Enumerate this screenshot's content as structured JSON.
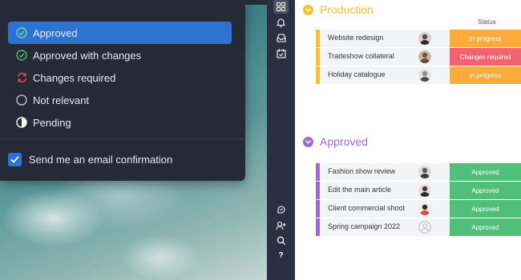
{
  "menu": {
    "options": [
      {
        "label": "Approved",
        "icon": "check-circle-icon",
        "selected": true
      },
      {
        "label": "Approved with changes",
        "icon": "check-circle-icon",
        "selected": false
      },
      {
        "label": "Changes required",
        "icon": "refresh-icon",
        "selected": false
      },
      {
        "label": "Not relevant",
        "icon": "empty-circle-icon",
        "selected": false
      },
      {
        "label": "Pending",
        "icon": "half-circle-icon",
        "selected": false
      }
    ],
    "email_confirmation": {
      "label": "Send me an email confirmation",
      "checked": true
    }
  },
  "sidebar": {
    "icons": [
      "grid-icon",
      "bell-icon",
      "inbox-icon",
      "calendar-check-icon",
      "feedback-icon",
      "add-user-icon",
      "search-icon",
      "help-icon"
    ],
    "help_glyph": "?"
  },
  "board": {
    "status_header": "Status",
    "groups": [
      {
        "title": "Production",
        "color": "#f2c230",
        "rows": [
          {
            "name": "Website redesign",
            "status": "In progress",
            "status_color": "#fdab3d"
          },
          {
            "name": "Tradeshow collateral",
            "status": "Changes required",
            "status_color": "#f2636f"
          },
          {
            "name": "Holiday catalogue",
            "status": "In progress",
            "status_color": "#fdab3d"
          }
        ]
      },
      {
        "title": "Approved",
        "color": "#9d6bc9",
        "rows": [
          {
            "name": "Fashion show review",
            "status": "Approved",
            "status_color": "#51bf79"
          },
          {
            "name": "Edit the main article",
            "status": "Approved",
            "status_color": "#51bf79"
          },
          {
            "name": "Client commercial shoot",
            "status": "Approved",
            "status_color": "#51bf79"
          },
          {
            "name": "Spring campaign 2022",
            "status": "Approved",
            "status_color": "#51bf79"
          }
        ]
      }
    ]
  }
}
